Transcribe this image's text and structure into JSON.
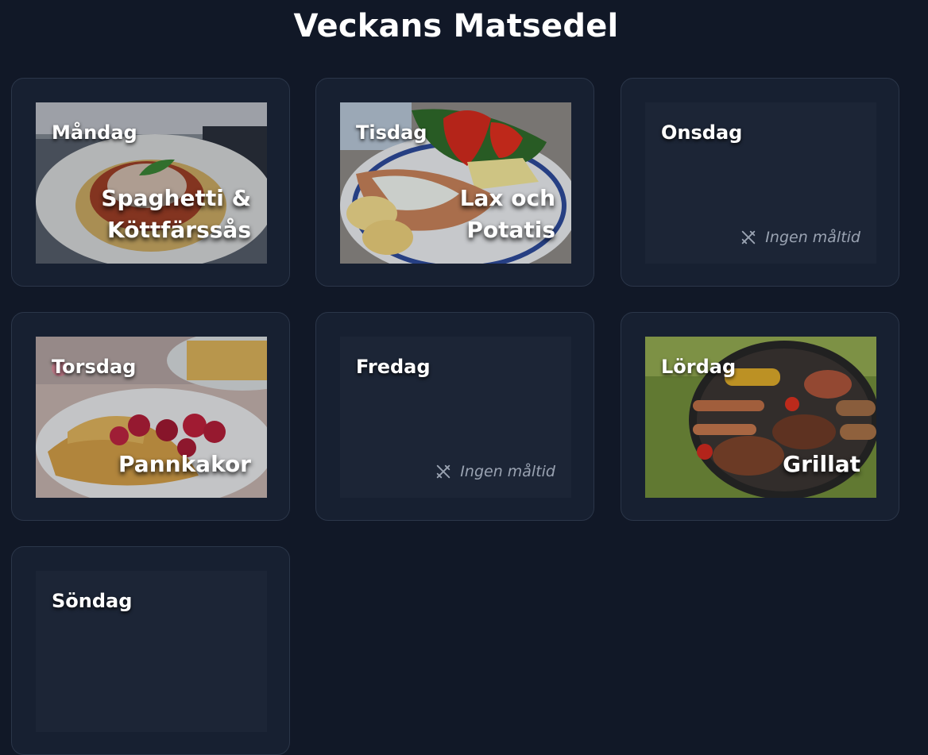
{
  "header": {
    "title": "Veckans Matsedel"
  },
  "days": [
    {
      "day": "Måndag",
      "meal": "Spaghetti & Köttfärssås",
      "has_meal": true,
      "image": "spaghetti-bolognese-photo"
    },
    {
      "day": "Tisdag",
      "meal": "Lax och Potatis",
      "has_meal": true,
      "image": "salmon-potatoes-salad-photo"
    },
    {
      "day": "Onsdag",
      "meal": "Ingen måltid",
      "has_meal": false,
      "icon": "no-food-icon"
    },
    {
      "day": "Torsdag",
      "meal": "Pannkakor",
      "has_meal": true,
      "image": "pancakes-raspberries-photo"
    },
    {
      "day": "Fredag",
      "meal": "Ingen måltid",
      "has_meal": false,
      "icon": "no-food-icon"
    },
    {
      "day": "Lördag",
      "meal": "Grillat",
      "has_meal": true,
      "image": "barbecue-grill-photo"
    },
    {
      "day": "Söndag",
      "meal": "",
      "has_meal": false
    }
  ],
  "colors": {
    "background": "#111827",
    "card": "#172031",
    "card_border": "#2b3649",
    "tile_empty": "#1c2536",
    "muted_text": "#9aa3b2"
  }
}
